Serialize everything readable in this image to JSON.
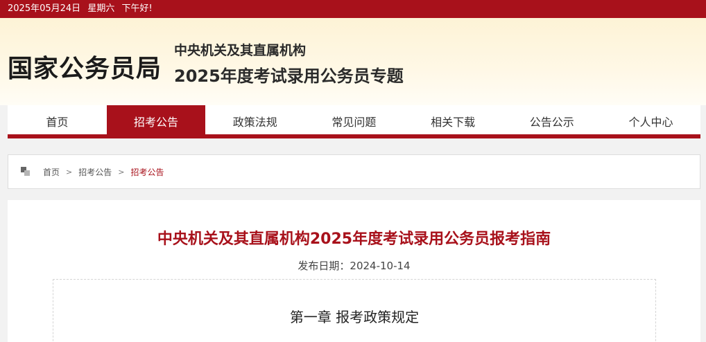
{
  "topbar": {
    "date": "2025年05月24日",
    "weekday": "星期六",
    "greeting": "下午好!"
  },
  "header": {
    "logo": "国家公务员局",
    "subtitle_1": "中央机关及其直属机构",
    "subtitle_2": "2025年度考试录用公务员专题"
  },
  "nav": {
    "active_index": 1,
    "items": [
      "首页",
      "招考公告",
      "政策法规",
      "常见问题",
      "相关下载",
      "公告公示",
      "个人中心"
    ]
  },
  "breadcrumb": {
    "items": [
      "首页",
      "招考公告"
    ],
    "current": "招考公告",
    "separator": ">"
  },
  "article": {
    "title": "中央机关及其直属机构2025年度考试录用公务员报考指南",
    "publish_date": "发布日期：2024-10-14",
    "chapter": "第一章  报考政策规定"
  },
  "colors": {
    "brand_red": "#a8111b",
    "header_bg": "#fdf3d6"
  }
}
